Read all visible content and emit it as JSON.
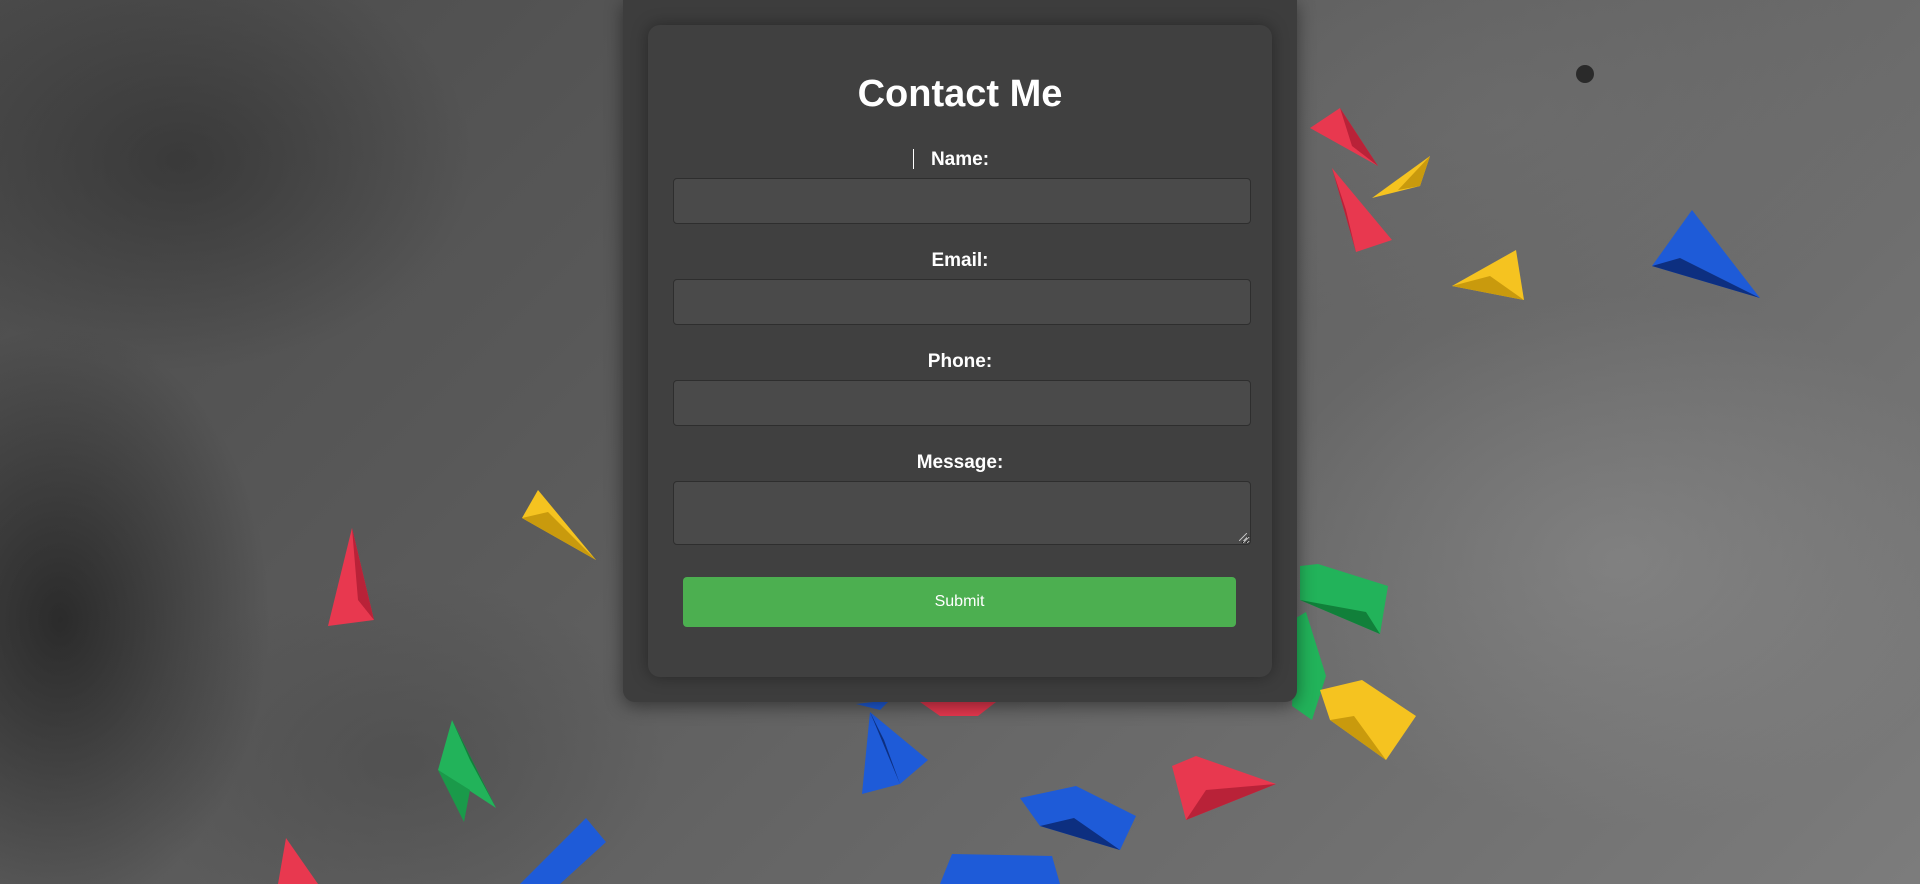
{
  "form": {
    "title": "Contact Me",
    "name_label": "Name:",
    "email_label": "Email:",
    "phone_label": "Phone:",
    "message_label": "Message:",
    "name_value": "",
    "email_value": "",
    "phone_value": "",
    "message_value": "",
    "submit_label": "Submit"
  },
  "colors": {
    "panel": "#3d3d3d",
    "card": "#404040",
    "input": "#4a4a4a",
    "submit": "#4caf50",
    "text": "#ffffff"
  },
  "background": {
    "icons": [
      "paper-plane-red-icon",
      "paper-plane-yellow-icon",
      "paper-plane-blue-icon",
      "paper-plane-green-icon"
    ]
  }
}
